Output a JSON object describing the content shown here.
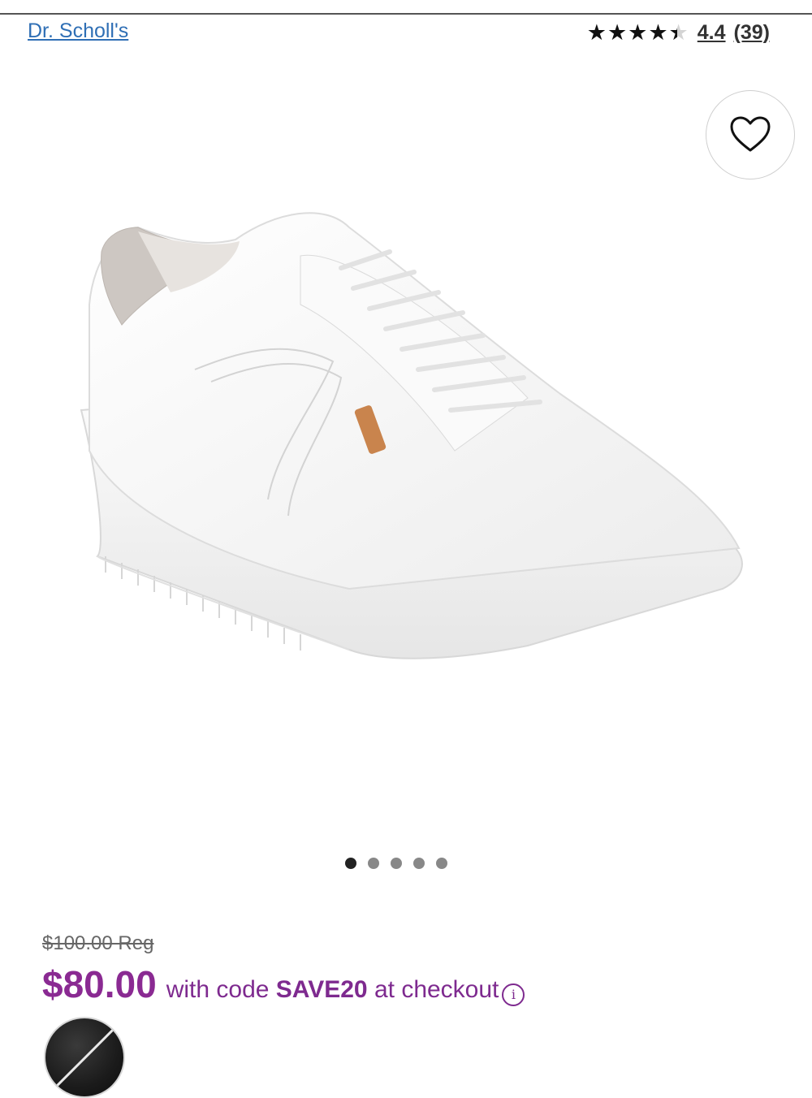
{
  "header": {
    "brand": "Dr. Scholl's",
    "rating": {
      "stars": 4.4,
      "value": "4.4",
      "count": "(39)"
    }
  },
  "product": {
    "image_icon": "white-platform-sneaker",
    "carousel": {
      "total": 5,
      "active": 1
    }
  },
  "pricing": {
    "regular": "$100.00 Reg",
    "sale": "$80.00",
    "promo_prefix": "with code ",
    "promo_code": "SAVE20",
    "promo_suffix": " at checkout",
    "accent_color": "#8a2a92"
  },
  "swatches": [
    {
      "color": "black",
      "selected": true
    }
  ],
  "icons": {
    "favorite": "heart-icon",
    "info": "info-icon"
  }
}
